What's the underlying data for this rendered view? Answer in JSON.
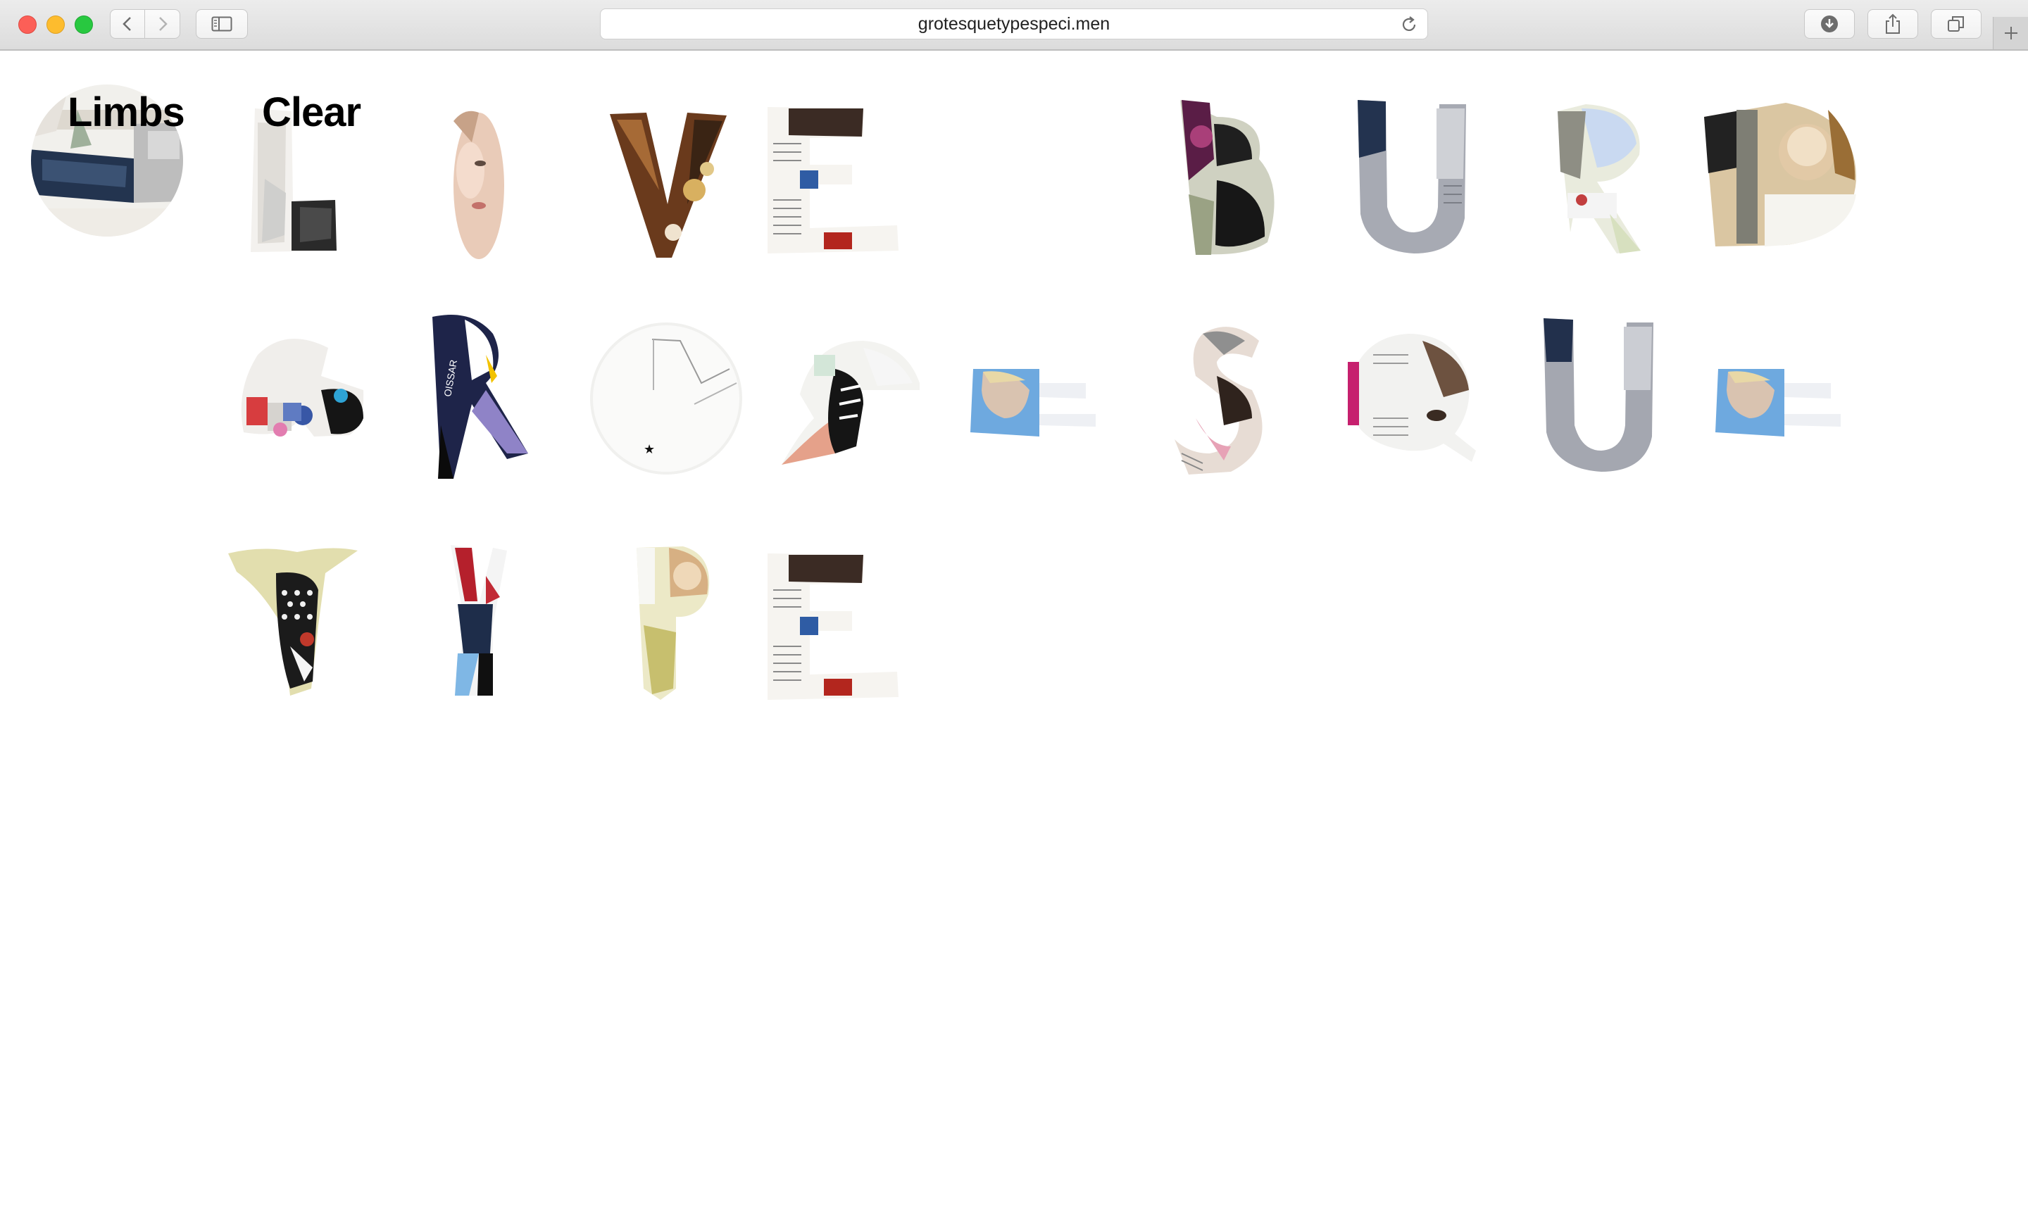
{
  "browser": {
    "url": "grotesquetypespeci.men"
  },
  "menu": {
    "limbs_label": "Limbs",
    "clear_label": "Clear"
  },
  "specimen_rows": [
    [
      "L",
      "I",
      "V",
      "E",
      "",
      "",
      "B",
      "U",
      "R",
      "D"
    ],
    [
      "",
      "G",
      "R",
      "O",
      "T",
      "E",
      "S",
      "Q",
      "U",
      "E"
    ],
    [
      "",
      "T",
      "Y",
      "P",
      "E"
    ]
  ],
  "icons": [
    "back-chevron-icon",
    "forward-chevron-icon",
    "sidebar-icon",
    "reload-icon",
    "download-icon",
    "share-icon",
    "tabs-icon",
    "plus-icon"
  ]
}
